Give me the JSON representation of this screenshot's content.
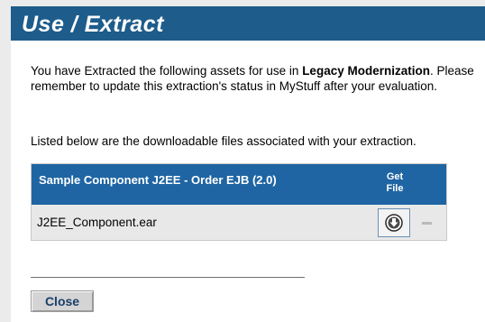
{
  "header": {
    "title": "Use / Extract"
  },
  "intro": {
    "text_before": "You have Extracted the following assets for use in ",
    "bold": "Legacy Modernization",
    "text_after": ". Please remember to update this extraction's status in MyStuff after your evaluation."
  },
  "listed_text": "Listed below are the downloadable files associated with your extraction.",
  "table": {
    "header_name": "Sample Component J2EE - Order EJB (2.0)",
    "header_get_line1": "Get",
    "header_get_line2": "File",
    "rows": [
      {
        "filename": "J2EE_Component.ear",
        "get_icon": "download-icon",
        "remove_icon": "minus-icon"
      }
    ]
  },
  "buttons": {
    "close_label": "Close"
  },
  "colors": {
    "header_bg": "#1d5c8b",
    "table_header_bg": "#1f65a3",
    "button_text": "#1a3f6b"
  }
}
